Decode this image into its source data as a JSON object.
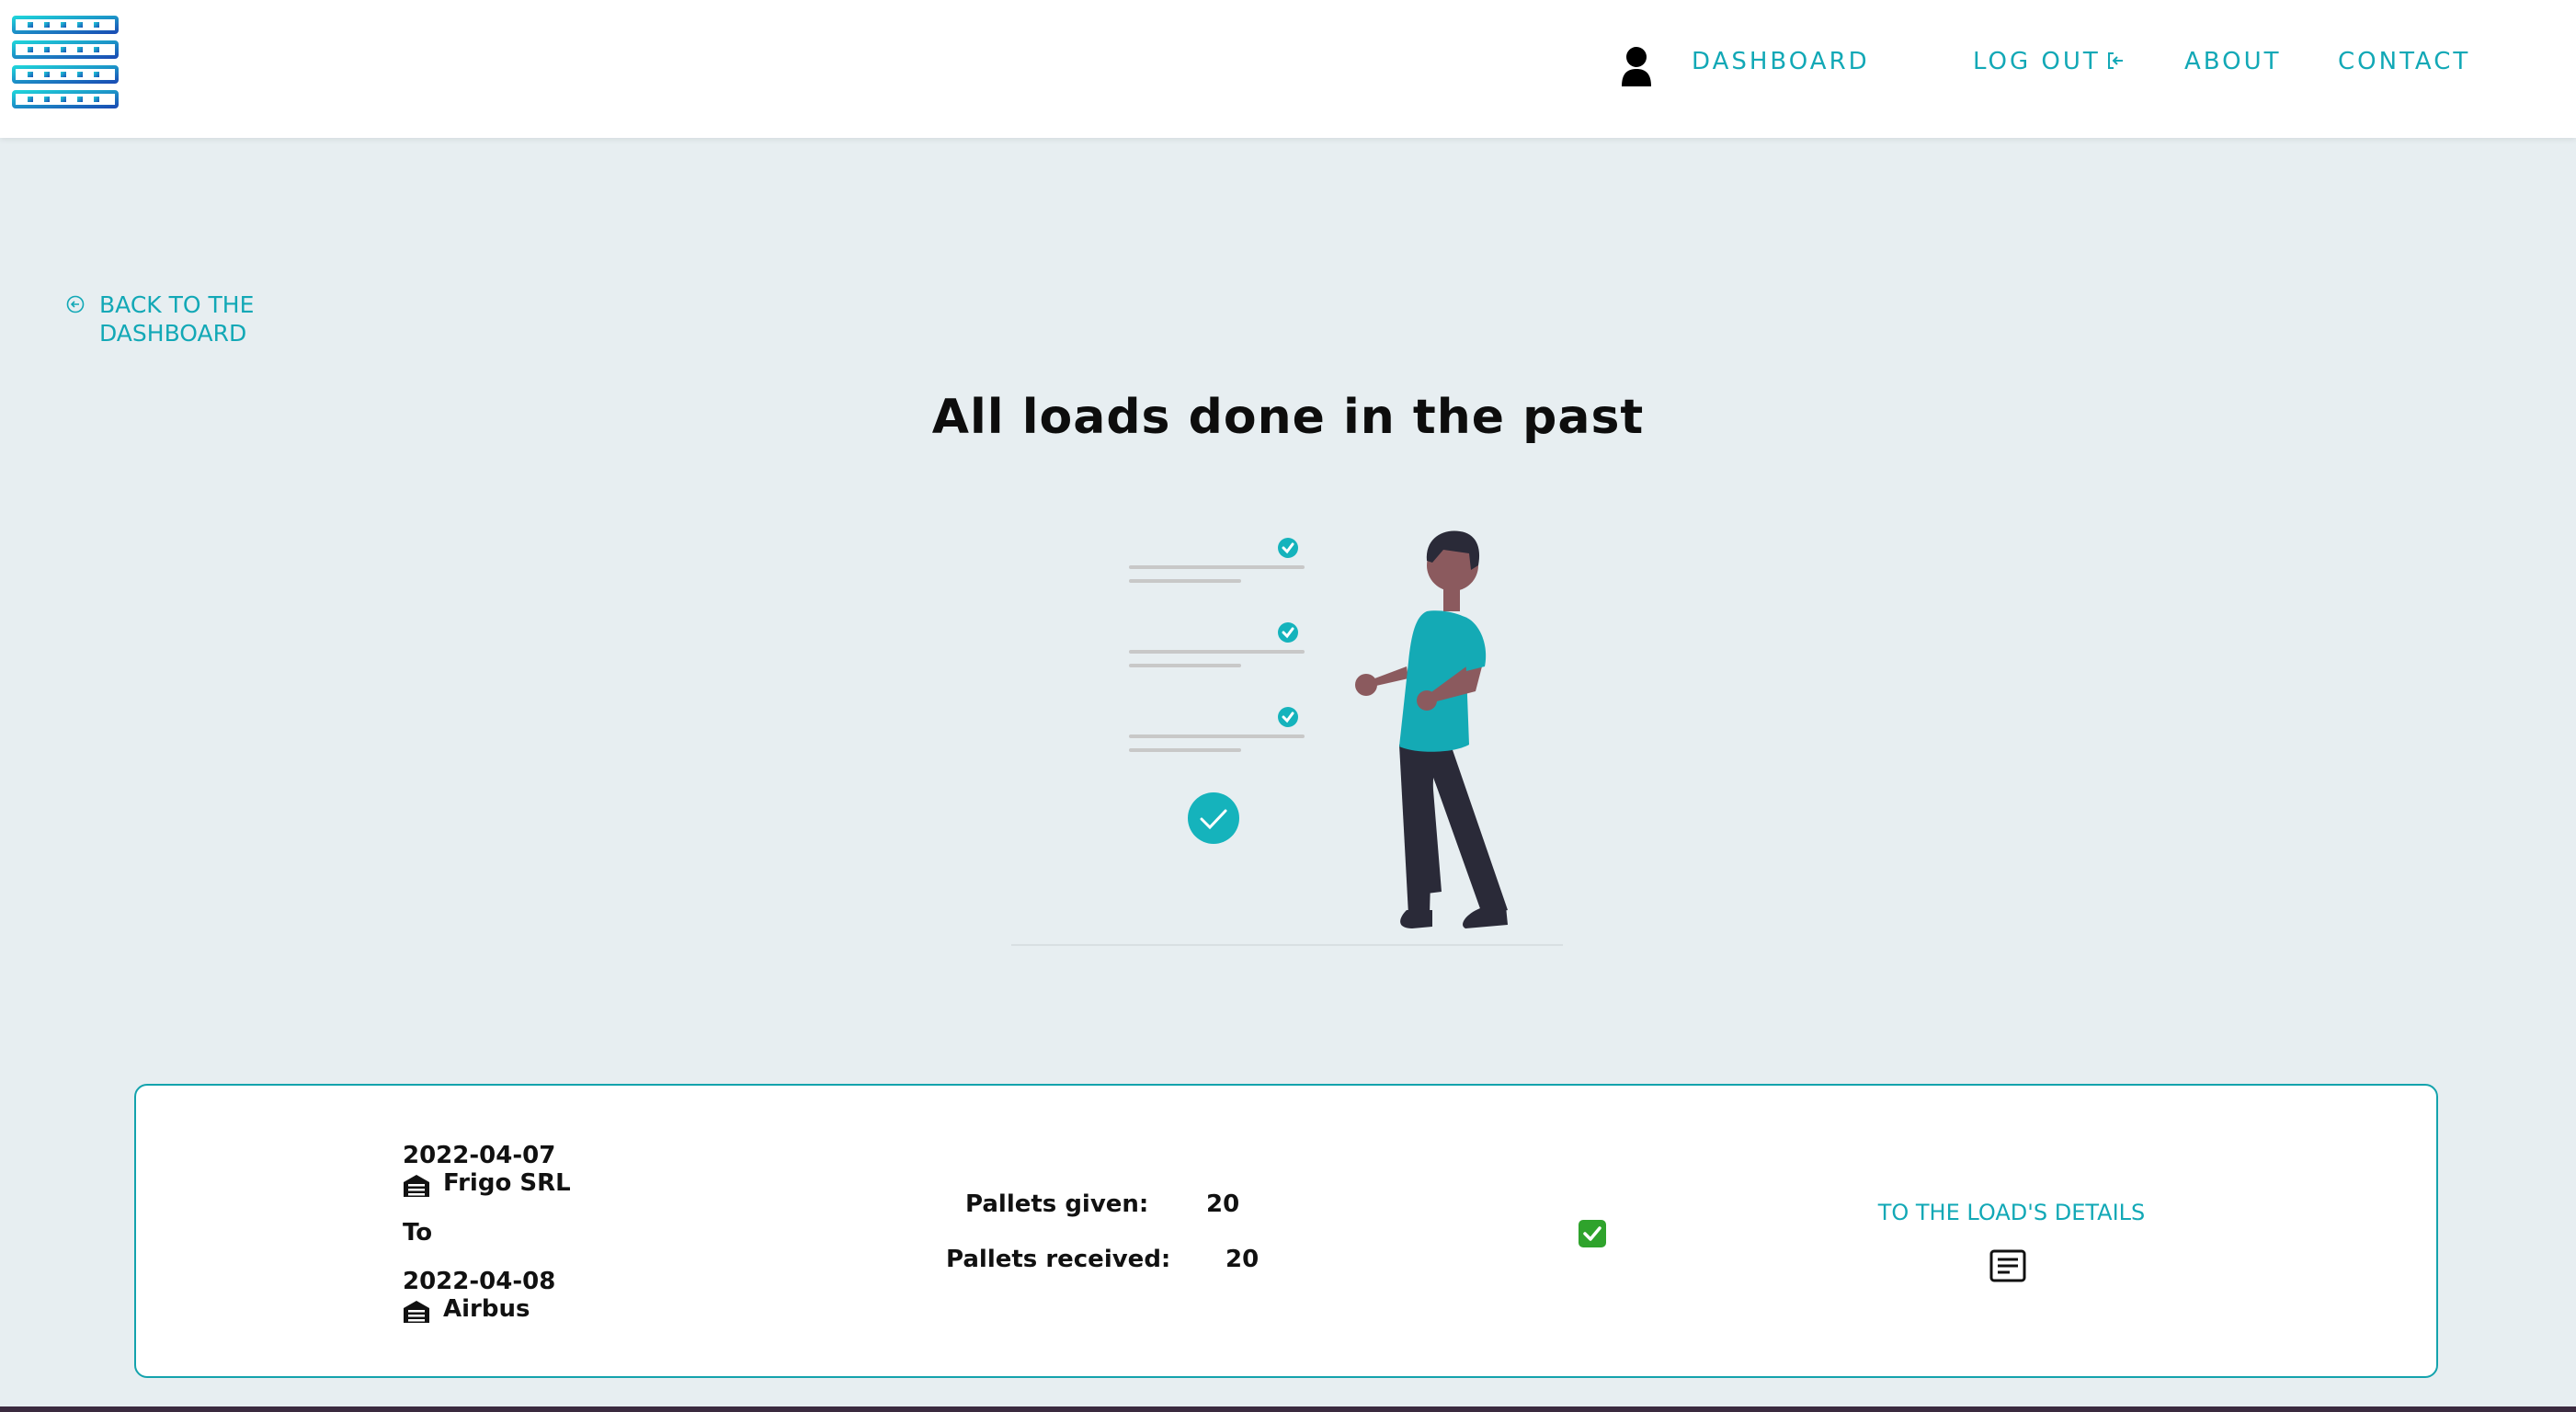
{
  "header": {
    "nav": {
      "dashboard": "DASHBOARD",
      "logout": "LOG OUT",
      "about": "ABOUT",
      "contact": "CONTACT"
    },
    "icons": {
      "logo": "server-rack-logo",
      "user": "user-icon",
      "logout": "logout-icon"
    }
  },
  "back_link": {
    "label": "BACK TO THE DASHBOARD",
    "icon": "back-arrow-circle-icon"
  },
  "page": {
    "title": "All loads done in the past"
  },
  "loads": [
    {
      "from_date": "2022-04-07",
      "from_company": "Frigo SRL",
      "connector": "To",
      "to_date": "2022-04-08",
      "to_company": "Airbus",
      "pallets_given_label": "Pallets given:",
      "pallets_given": "20",
      "pallets_received_label": "Pallets received:",
      "pallets_received": "20",
      "status_icon": "green-checkmark-icon",
      "details_label": "TO THE LOAD'S DETAILS",
      "details_icon": "document-icon"
    }
  ],
  "colors": {
    "accent": "#12a8b6",
    "background": "#e7eef1",
    "card_border": "#14a3ad",
    "success": "#2fa32c"
  }
}
